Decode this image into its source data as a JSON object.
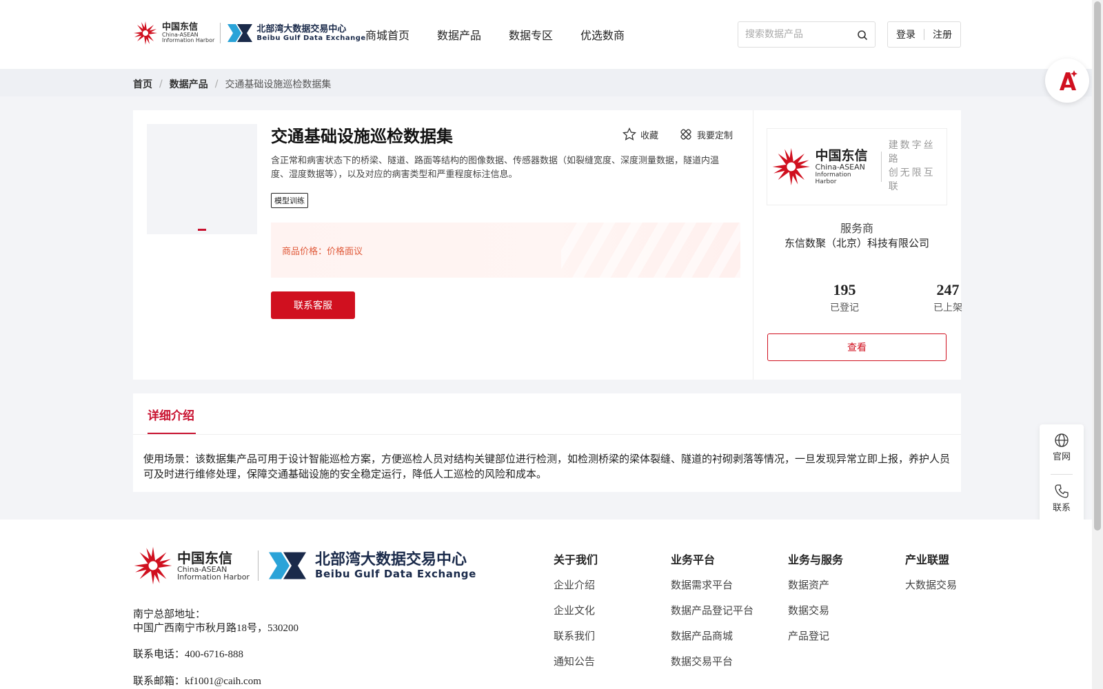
{
  "header": {
    "logo_cn": "中国东信",
    "logo_en1": "China-ASEAN",
    "logo_en2": "Information Harbor",
    "bx_cn": "北部湾大数据交易中心",
    "bx_en": "Beibu Gulf Data Exchange",
    "nav": [
      "商城首页",
      "数据产品",
      "数据专区",
      "优选数商"
    ],
    "search_placeholder": "搜索数据产品",
    "login": "登录",
    "register": "注册"
  },
  "breadcrumb": {
    "home": "首页",
    "category": "数据产品",
    "current": "交通基础设施巡检数据集"
  },
  "product": {
    "title": "交通基础设施巡检数据集",
    "favorite": "收藏",
    "customize": "我要定制",
    "description": "含正常和病害状态下的桥梁、隧道、路面等结构的图像数据、传感器数据（如裂缝宽度、深度测量数据，隧道内温度、湿度数据等），以及对应的病害类型和严重程度标注信息。",
    "tag": "模型训练",
    "price_label": "商品价格：",
    "price_value": "价格面议",
    "contact_button": "联系客服"
  },
  "vendor": {
    "logo_cn": "中国东信",
    "logo_en1": "China-ASEAN",
    "logo_en2": "Information Harbor",
    "slogan1": "建数字丝路",
    "slogan2": "创无限互联",
    "label": "服务商",
    "name": "东信数聚（北京）科技有限公司",
    "registered_count": "195",
    "registered_label": "已登记",
    "listed_count": "247",
    "listed_label": "已上架",
    "view_button": "查看"
  },
  "detail": {
    "tab": "详细介绍",
    "text": "使用场景：该数据集产品可用于设计智能巡检方案，方便巡检人员对结构关键部位进行检测，如检测桥梁的梁体裂缝、隧道的衬砌剥落等情况，一旦发现异常立即上报，养护人员可及时进行维修处理，保障交通基础设施的安全稳定运行，降低人工巡检的风险和成本。"
  },
  "side_float": {
    "official": "官网",
    "contact": "联系"
  },
  "footer": {
    "address_label": "南宁总部地址：",
    "address": "中国广西南宁市秋月路18号，530200",
    "phone": "联系电话：400-6716-888",
    "email": "联系邮箱：kf1001@caih.com",
    "columns": [
      {
        "title": "关于我们",
        "links": [
          "企业介绍",
          "企业文化",
          "联系我们",
          "通知公告"
        ]
      },
      {
        "title": "业务平台",
        "links": [
          "数据需求平台",
          "数据产品登记平台",
          "数据产品商城",
          "数据交易平台"
        ]
      },
      {
        "title": "业务与服务",
        "links": [
          "数据资产",
          "数据交易",
          "产品登记"
        ]
      },
      {
        "title": "产业联盟",
        "links": [
          "大数据交易"
        ]
      }
    ]
  },
  "colors": {
    "brand_red": "#d0101f",
    "price_text": "#e05a3a",
    "navy": "#1a2a4a",
    "teal": "#2aa3d8"
  },
  "icons": [
    "search-icon",
    "star-icon",
    "customize-icon",
    "ai-assistant-icon",
    "globe-icon",
    "phone-icon"
  ]
}
